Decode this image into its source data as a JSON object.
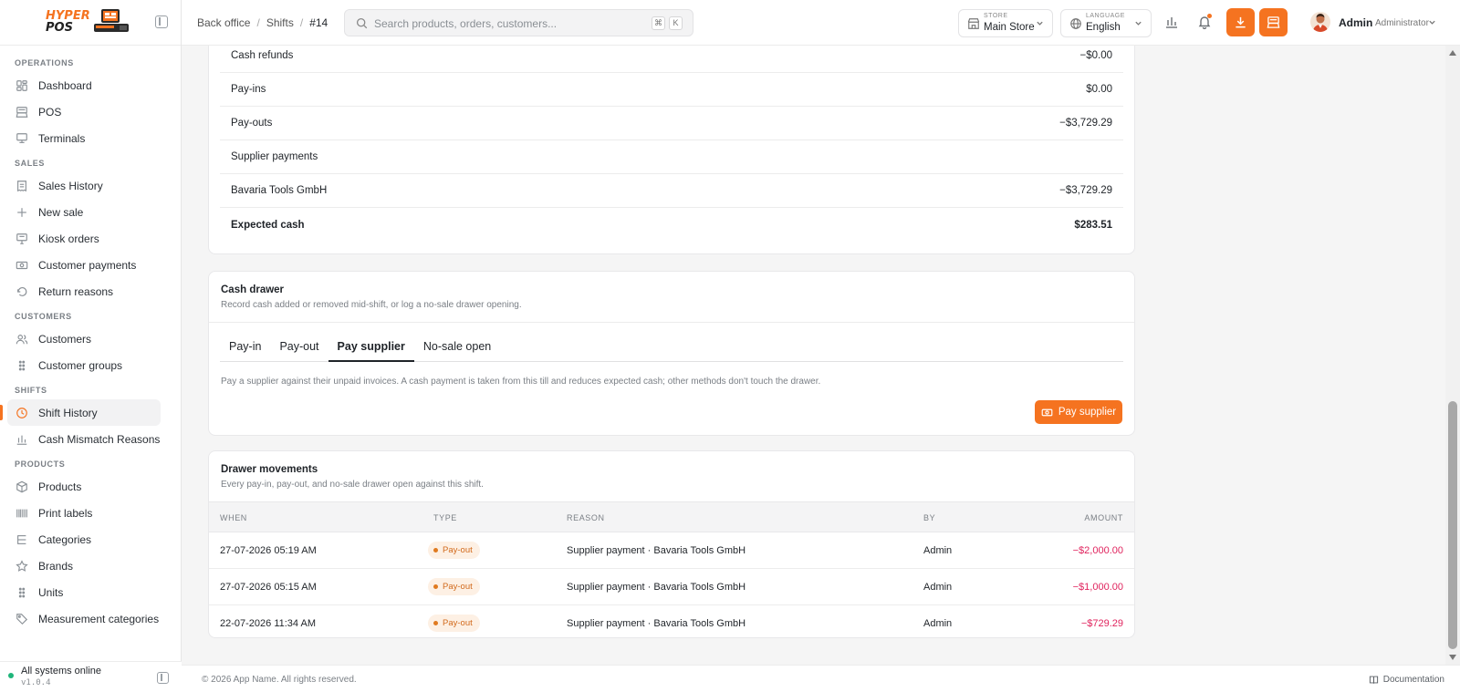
{
  "brand": {
    "logo_line1": "HYPER",
    "logo_line2": "POS",
    "accent": "#f57320"
  },
  "sidebar": {
    "sections": [
      {
        "title": "OPERATIONS",
        "items": [
          {
            "label": "Dashboard",
            "icon": "dashboard-icon"
          },
          {
            "label": "POS",
            "icon": "pos-icon"
          },
          {
            "label": "Terminals",
            "icon": "terminal-icon"
          }
        ]
      },
      {
        "title": "SALES",
        "items": [
          {
            "label": "Sales History",
            "icon": "receipt-icon"
          },
          {
            "label": "New sale",
            "icon": "plus-icon"
          },
          {
            "label": "Kiosk orders",
            "icon": "kiosk-icon"
          },
          {
            "label": "Customer payments",
            "icon": "cash-icon"
          },
          {
            "label": "Return reasons",
            "icon": "undo-icon"
          }
        ]
      },
      {
        "title": "CUSTOMERS",
        "items": [
          {
            "label": "Customers",
            "icon": "users-icon"
          },
          {
            "label": "Customer groups",
            "icon": "grip-icon"
          }
        ]
      },
      {
        "title": "SHIFTS",
        "items": [
          {
            "label": "Shift History",
            "icon": "clock-icon",
            "active": true
          },
          {
            "label": "Cash Mismatch Reasons",
            "icon": "bar-chart-icon"
          }
        ]
      },
      {
        "title": "PRODUCTS",
        "items": [
          {
            "label": "Products",
            "icon": "box-icon"
          },
          {
            "label": "Print labels",
            "icon": "barcode-icon"
          },
          {
            "label": "Categories",
            "icon": "list-tree-icon"
          },
          {
            "label": "Brands",
            "icon": "star-icon"
          },
          {
            "label": "Units",
            "icon": "grip-icon"
          },
          {
            "label": "Measurement categories",
            "icon": "tag-icon"
          }
        ]
      }
    ],
    "status": "All systems online",
    "version": "v1.0.4"
  },
  "header": {
    "breadcrumb": [
      "Back office",
      "Shifts",
      "#14"
    ],
    "search_placeholder": "Search products, orders, customers...",
    "search_kbd": [
      "⌘",
      "K"
    ],
    "store_label": "STORE",
    "store_value": "Main Store",
    "language_label": "LANGUAGE",
    "language_value": "English",
    "user_name": "Admin",
    "user_role": "Administrator"
  },
  "summary": {
    "rows": [
      {
        "label": "Cash refunds",
        "value": "−$0.00"
      },
      {
        "label": "Pay-ins",
        "value": "$0.00"
      },
      {
        "label": "Pay-outs",
        "value": "−$3,729.29"
      },
      {
        "label": "Supplier payments",
        "value": ""
      },
      {
        "label": "Bavaria Tools GmbH",
        "value": "−$3,729.29"
      },
      {
        "label": "Expected cash",
        "value": "$283.51"
      }
    ]
  },
  "cash_drawer": {
    "title": "Cash drawer",
    "subtitle": "Record cash added or removed mid-shift, or log a no-sale drawer opening.",
    "tabs": [
      "Pay-in",
      "Pay-out",
      "Pay supplier",
      "No-sale open"
    ],
    "active_tab": "Pay supplier",
    "description": "Pay a supplier against their unpaid invoices. A cash payment is taken from this till and reduces expected cash; other methods don't touch the drawer.",
    "button_label": "Pay supplier"
  },
  "movements": {
    "title": "Drawer movements",
    "subtitle": "Every pay-in, pay-out, and no-sale drawer open against this shift.",
    "columns": [
      "WHEN",
      "TYPE",
      "REASON",
      "BY",
      "AMOUNT"
    ],
    "rows": [
      {
        "when": "27-07-2026 05:19 AM",
        "type": "Pay-out",
        "reason": "Supplier payment · Bavaria Tools GmbH",
        "by": "Admin",
        "amount": "−$2,000.00"
      },
      {
        "when": "27-07-2026 05:15 AM",
        "type": "Pay-out",
        "reason": "Supplier payment · Bavaria Tools GmbH",
        "by": "Admin",
        "amount": "−$1,000.00"
      },
      {
        "when": "22-07-2026 11:34 AM",
        "type": "Pay-out",
        "reason": "Supplier payment · Bavaria Tools GmbH",
        "by": "Admin",
        "amount": "−$729.29"
      }
    ]
  },
  "footer": {
    "copyright": "© 2026 App Name. All rights reserved.",
    "documentation": "Documentation"
  }
}
